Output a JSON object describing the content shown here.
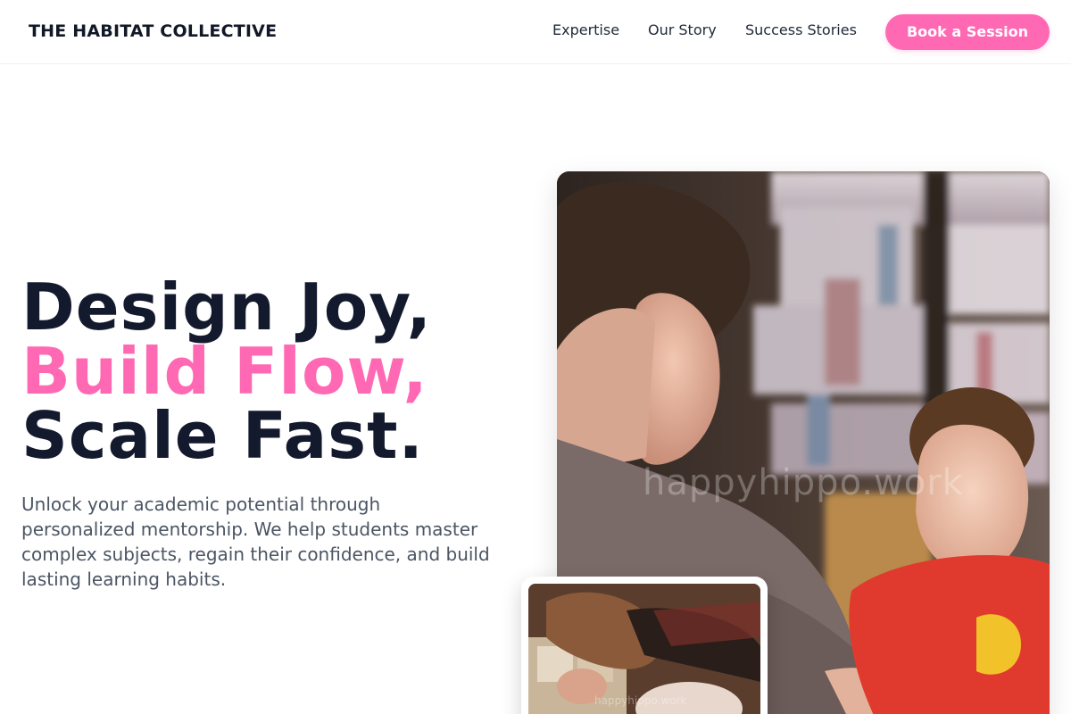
{
  "header": {
    "brand": "THE HABITAT COLLECTIVE",
    "nav": [
      {
        "label": "Expertise"
      },
      {
        "label": "Our Story"
      },
      {
        "label": "Success Stories"
      }
    ],
    "cta_label": "Book a Session"
  },
  "hero": {
    "line1": "Design Joy,",
    "line2": "Build Flow,",
    "line3": "Scale Fast.",
    "description": "Unlock your academic potential through personalized mentorship. We help students master complex subjects, regain their confidence, and build lasting learning habits."
  },
  "images": {
    "main_watermark": "happyhippo.work",
    "inset_watermark": "happyhippo.work"
  },
  "colors": {
    "accent": "#ff69b4",
    "heading": "#141a2e",
    "body_text": "#4b5563"
  }
}
